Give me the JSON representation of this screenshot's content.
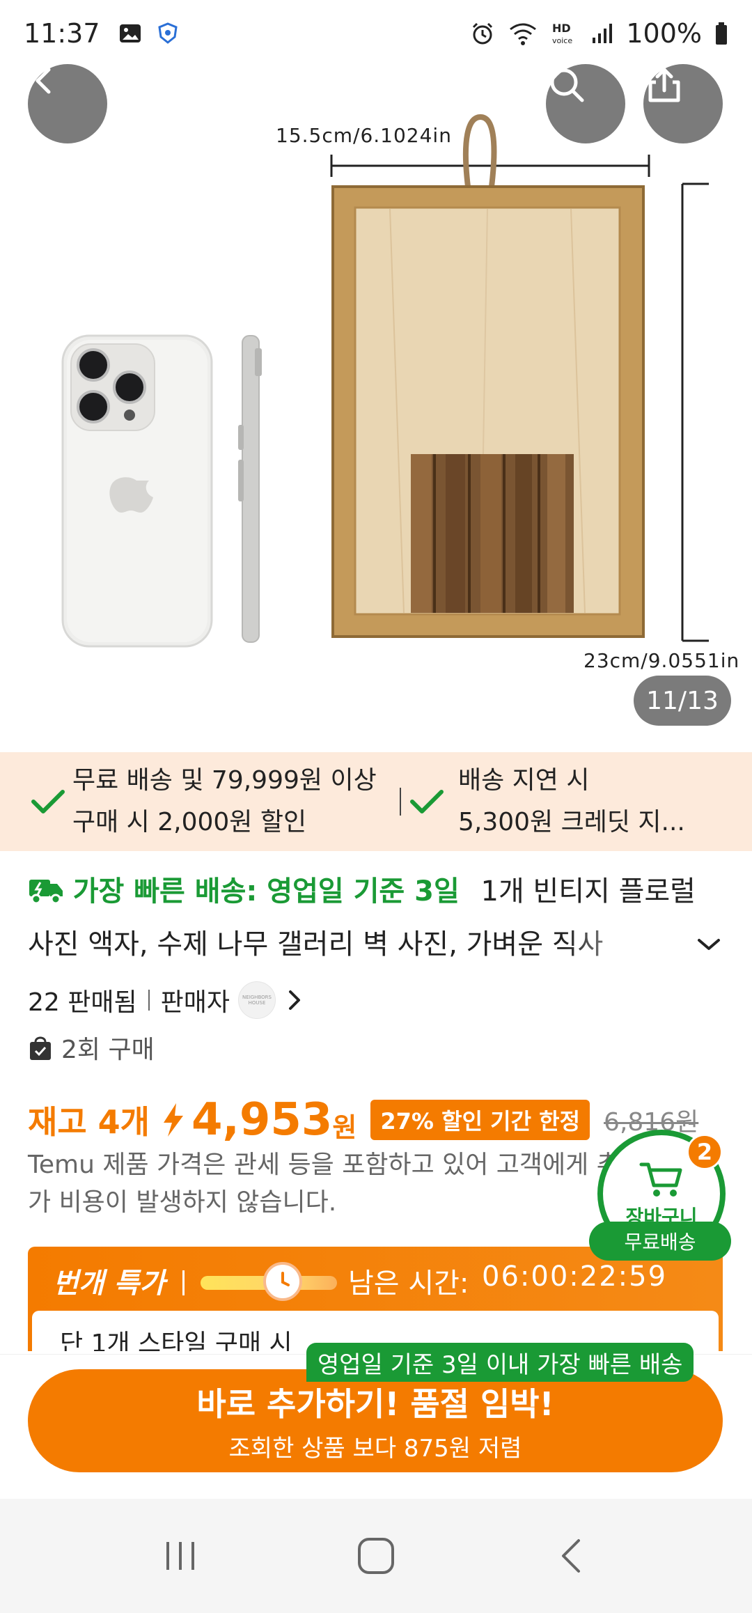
{
  "status_bar": {
    "time": "11:37",
    "battery": "100%"
  },
  "gallery": {
    "counter": "11/13",
    "width_label": "15.5cm/6.1024in",
    "height_label": "23cm/9.0551in"
  },
  "benefits": [
    {
      "line1": "무료 배송 및 79,999원 이상",
      "line2": "구매 시 2,000원 할인"
    },
    {
      "line1": "배송 지연 시",
      "line2": "5,300원 크레딧 지..."
    }
  ],
  "product": {
    "fast_shipping": "가장 빠른 배송: 영업일 기준 3일",
    "title_part1": "1개 빈티지 플로럴",
    "title_line2": "사진 액자, 수제 나무 갤러리 벽 사진, 가벼운 직사",
    "sold": "22 판매됨",
    "seller_label": "판매자",
    "seller_logo": "NEIGHBORS HOUSE",
    "purchase_count": "2회 구매"
  },
  "price": {
    "stock": "재고 4개",
    "amount": "4,953",
    "currency": "원",
    "discount_badge": "27% 할인 기간 한정",
    "original": "6,816원",
    "tax_note": "Temu 제품 가격은 관세 등을 포함하고 있어 고객에게 추가 비용이 발생하지 않습니다."
  },
  "flash_sale": {
    "title": "번개 특가",
    "remaining_label": "남은 시간:",
    "timer": "06:00:22:59",
    "progress": 0.6,
    "inner_text": "단 1개 스타일 구매 시"
  },
  "cart": {
    "label": "장바구니",
    "count": "2",
    "free_shipping": "무료배송"
  },
  "cta": {
    "fast_tag": "영업일 기준 3일 이내 가장 빠른 배송",
    "main": "바로 추가하기! 품절 임박!",
    "sub": "조회한 상품 보다 875원 저렴"
  },
  "colors": {
    "accent": "#f47b00",
    "green": "#1a9a35",
    "banner_bg": "#fdeadb"
  }
}
